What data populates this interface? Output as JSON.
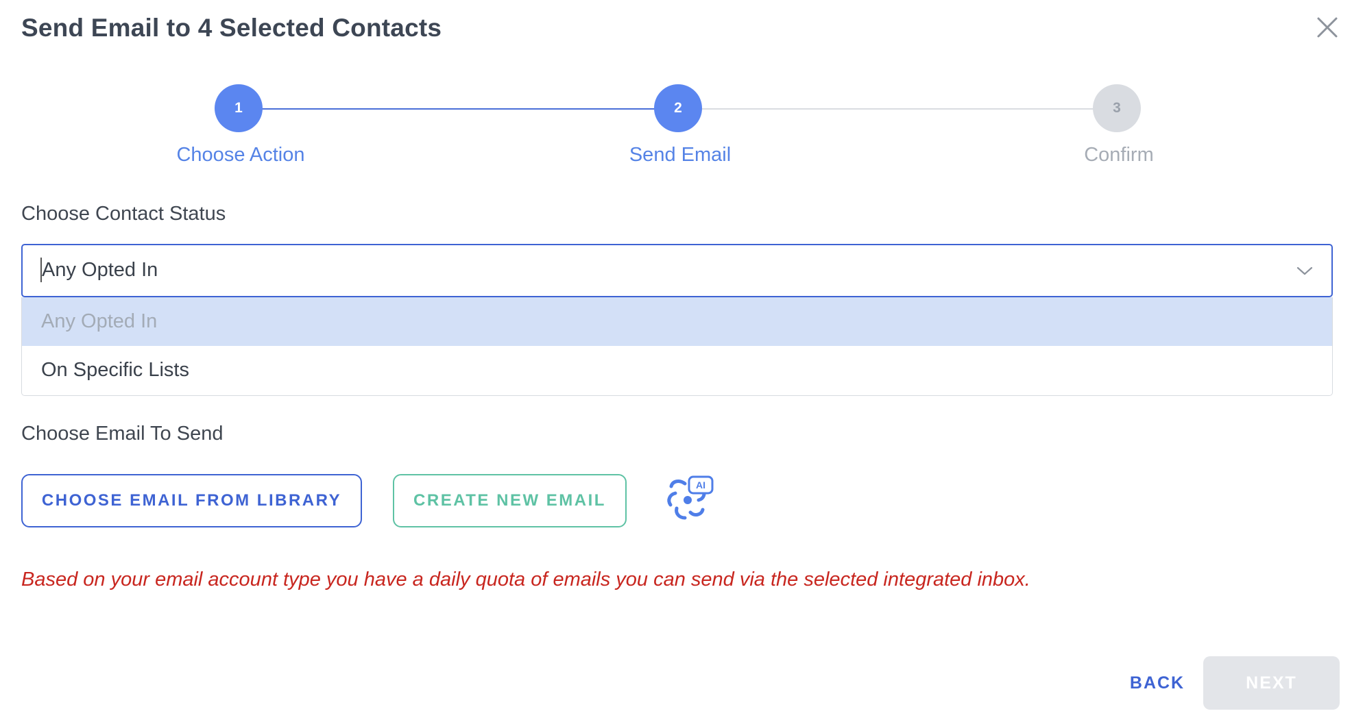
{
  "dialog": {
    "title": "Send Email to 4 Selected Contacts",
    "close_icon": "close-icon"
  },
  "stepper": {
    "steps": [
      {
        "number": "1",
        "label": "Choose Action",
        "state": "completed"
      },
      {
        "number": "2",
        "label": "Send Email",
        "state": "active"
      },
      {
        "number": "3",
        "label": "Confirm",
        "state": "inactive"
      }
    ]
  },
  "contact_status": {
    "label": "Choose Contact Status",
    "selected_value": "Any Opted In",
    "chevron_icon": "chevron-down-icon",
    "options": [
      {
        "label": "Any Opted In",
        "selected": true
      },
      {
        "label": "On Specific Lists",
        "selected": false
      }
    ]
  },
  "email_section": {
    "label": "Choose Email To Send",
    "library_button": "CHOOSE EMAIL FROM LIBRARY",
    "create_button": "CREATE NEW EMAIL",
    "ai_badge": "AI",
    "ai_icon": "ai-sparkle-icon"
  },
  "notice": {
    "text": "Based on your email account type you have a daily quota of emails you can send via the selected integrated inbox."
  },
  "footer": {
    "back_label": "BACK",
    "next_label": "NEXT",
    "next_enabled": false
  },
  "colors": {
    "primary": "#3e63d3",
    "step_active": "#5b86f0",
    "step_inactive": "#d9dce1",
    "create_green": "#5ec2a4",
    "notice_red": "#c8261f",
    "option_highlight": "#d3e0f7"
  }
}
